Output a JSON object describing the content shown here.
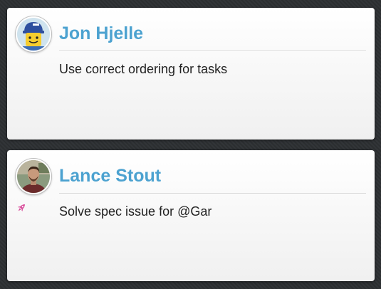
{
  "colors": {
    "name": "#4ca2d0",
    "message": "#222222",
    "rocket": "#d94f9c"
  },
  "posts": [
    {
      "author": "Jon Hjelle",
      "avatar_icon": "lego-minifig-avatar",
      "message": "Use correct ordering for tasks"
    },
    {
      "author": "Lance Stout",
      "avatar_icon": "person-photo-avatar",
      "status_icon": "rocket-icon",
      "message": "Solve spec issue for @Gar"
    }
  ]
}
